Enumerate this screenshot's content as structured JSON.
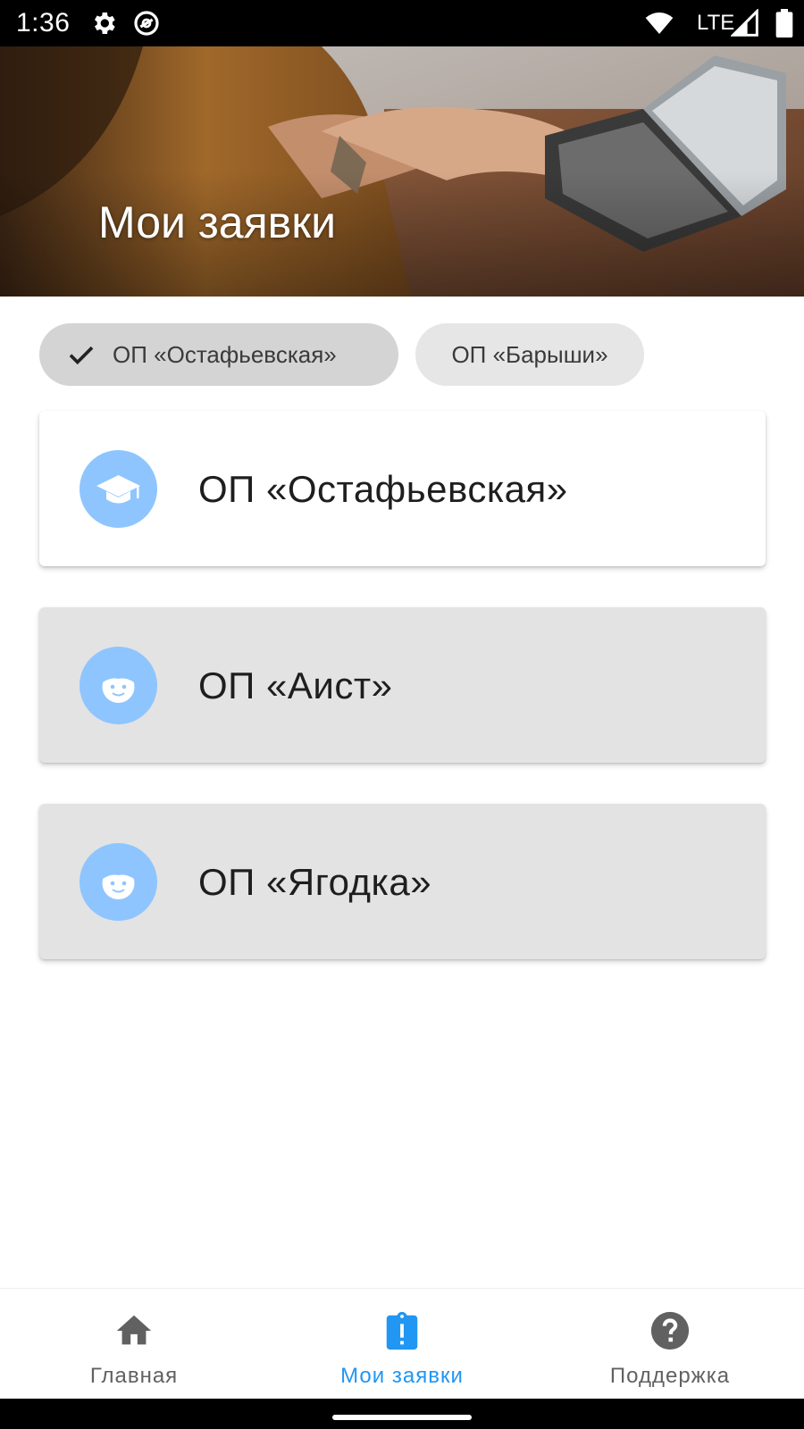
{
  "status_bar": {
    "time": "1:36",
    "network": "LTE",
    "icons": [
      "gear-icon",
      "data-saver-icon",
      "wifi-icon",
      "signal-icon",
      "battery-icon"
    ]
  },
  "header": {
    "title": "Мои заявки"
  },
  "filters": {
    "chips": [
      {
        "label": "ОП «Остафьевская»",
        "selected": true,
        "icon": "check-icon"
      },
      {
        "label": "ОП «Барыши»",
        "selected": false
      }
    ]
  },
  "requests": {
    "items": [
      {
        "label": "ОП «Остафьевская»",
        "icon": "graduation-cap-icon",
        "highlighted": true
      },
      {
        "label": "ОП «Аист»",
        "icon": "child-face-icon",
        "highlighted": false
      },
      {
        "label": "ОП «Ягодка»",
        "icon": "child-face-icon",
        "highlighted": false
      }
    ]
  },
  "bottom_nav": {
    "items": [
      {
        "label": "Главная",
        "icon": "home-icon",
        "active": false
      },
      {
        "label": "Мои заявки",
        "icon": "clipboard-alert-icon",
        "active": true
      },
      {
        "label": "Поддержка",
        "icon": "help-circle-icon",
        "active": false
      }
    ]
  },
  "colors": {
    "accent": "#2196f3",
    "avatar": "#8ec5ff",
    "nav_inactive": "#616161",
    "chip_selected": "#d4d4d4",
    "chip_default": "#e6e6e6",
    "card_default": "#e3e3e3"
  }
}
